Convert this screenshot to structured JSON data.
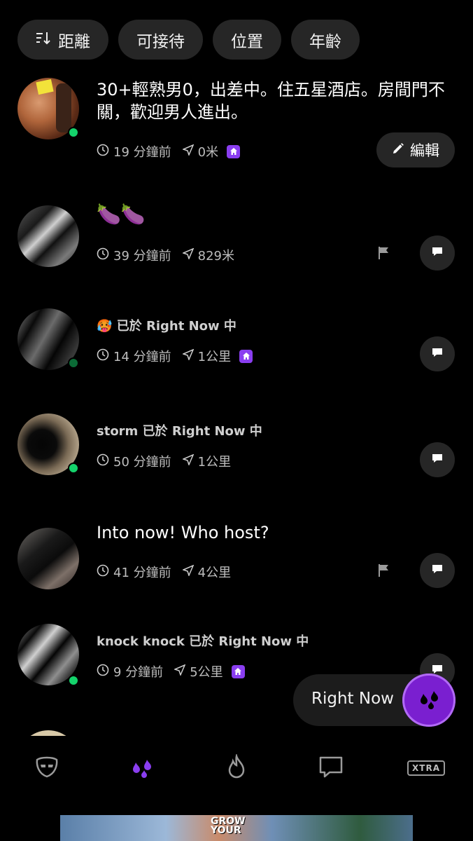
{
  "filters": [
    {
      "label": "距離",
      "icon": "sort-icon"
    },
    {
      "label": "可接待"
    },
    {
      "label": "位置"
    },
    {
      "label": "年齡"
    }
  ],
  "feed": [
    {
      "message": "30+輕熟男0，出差中。住五星酒店。房間門不關，歡迎男人進出。",
      "time": "19 分鐘前",
      "distance": "0米",
      "host": true,
      "online": true,
      "action": "編輯"
    },
    {
      "message": "🍆🍆",
      "time": "39 分鐘前",
      "distance": "829米",
      "host": false,
      "online": false,
      "flag": true
    },
    {
      "message_emoji": "🥵",
      "message": "已於 Right Now 中",
      "time": "14 分鐘前",
      "distance": "1公里",
      "host": true,
      "online": true
    },
    {
      "message": "storm 已於 Right Now 中",
      "time": "50 分鐘前",
      "distance": "1公里",
      "host": false,
      "online": true
    },
    {
      "message": "Into now! Who host?",
      "time": "41 分鐘前",
      "distance": "4公里",
      "host": false,
      "online": false,
      "flag": true
    },
    {
      "message": "knock knock 已於 Right Now 中",
      "time": "9 分鐘前",
      "distance": "5公里",
      "host": true,
      "online": true
    }
  ],
  "right_now": {
    "label": "Right Now"
  },
  "tabbar": {
    "xtra": "XTRA",
    "accent": "#8a3ef0"
  },
  "ad": {
    "text_line1": "GROW",
    "text_line2": "YOUR"
  }
}
